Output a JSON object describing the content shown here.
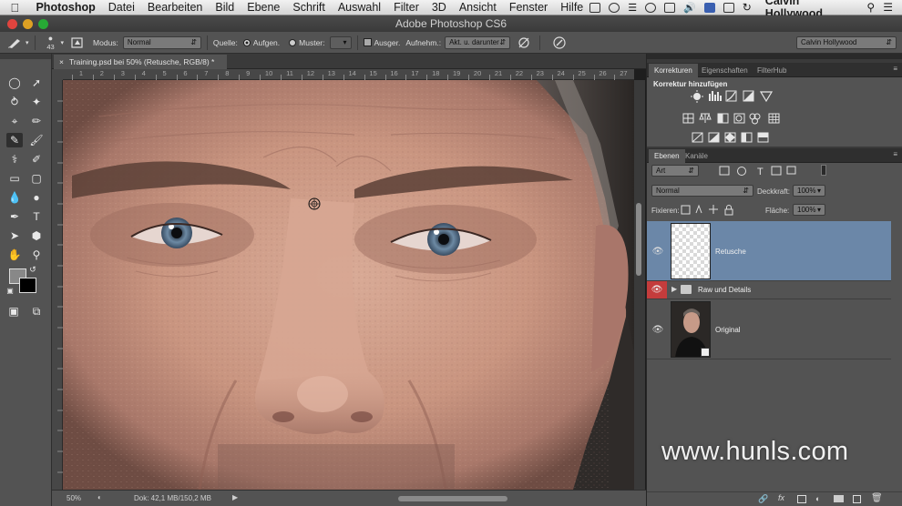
{
  "menubar": {
    "app": "Photoshop",
    "items": [
      "Datei",
      "Bearbeiten",
      "Bild",
      "Ebene",
      "Schrift",
      "Auswahl",
      "Filter",
      "3D",
      "Ansicht",
      "Fenster",
      "Hilfe"
    ],
    "user": "Calvin Hollywood"
  },
  "window": {
    "title": "Adobe Photoshop CS6"
  },
  "options": {
    "brush_size": "43",
    "modus_label": "Modus:",
    "modus_value": "Normal",
    "quelle_label": "Quelle:",
    "aufgen_label": "Aufgen.",
    "muster_label": "Muster:",
    "ausger_label": "Ausger.",
    "aufnehm_label": "Aufnehm.:",
    "aufnehm_value": "Akt. u. darunter",
    "workspace": "Calvin Hollywood"
  },
  "document": {
    "tab_title": "Training.psd bei 50% (Retusche, RGB/8) *",
    "close_glyph": "×"
  },
  "rulers": {
    "h_ticks": [
      "1",
      "2",
      "3",
      "4",
      "5",
      "6",
      "7",
      "8",
      "9",
      "10",
      "11",
      "12",
      "13",
      "14",
      "15",
      "16",
      "17",
      "18",
      "19",
      "20",
      "21",
      "22",
      "23",
      "24",
      "25",
      "26",
      "27"
    ]
  },
  "status": {
    "zoom": "50%",
    "doc_size": "Dok: 42,1 MB/150,2 MB"
  },
  "adjustments": {
    "tabs": [
      "Korrekturen",
      "Eigenschaften",
      "FilterHub"
    ],
    "heading": "Korrektur hinzufügen"
  },
  "layers": {
    "tabs": [
      "Ebenen",
      "Kanäle"
    ],
    "filter_value": "Art",
    "blend_mode": "Normal",
    "opacity_label": "Deckkraft:",
    "opacity_value": "100%",
    "lock_label": "Fixieren:",
    "fill_label": "Fläche:",
    "fill_value": "100%",
    "items": [
      {
        "name": "Retusche",
        "selected": true
      },
      {
        "name": "Raw und Details",
        "group": true
      },
      {
        "name": "Original"
      }
    ]
  },
  "watermark": "www.hunls.com",
  "colors": {
    "panel_bg": "#535353",
    "selected_layer": "#6b87a8",
    "eye_red": "#cc3b3b"
  }
}
